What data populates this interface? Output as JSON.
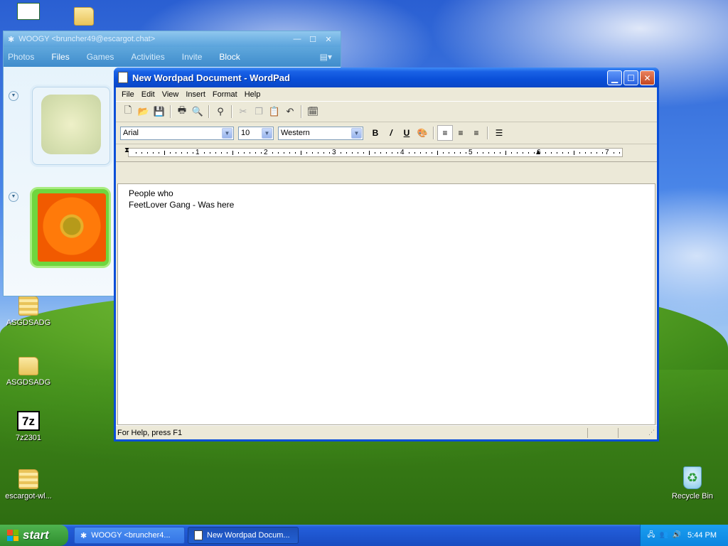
{
  "desktop": {
    "icons": [
      {
        "label": "ASGDSADG"
      },
      {
        "label": "ASGDSADG"
      },
      {
        "label": "7z2301"
      },
      {
        "label": "escargot-wl..."
      },
      {
        "label": "Recycle Bin"
      }
    ]
  },
  "messenger": {
    "title": "WOOGY <bruncher49@escargot.chat>",
    "tabs": [
      "Photos",
      "Files",
      "Games",
      "Activities",
      "Invite",
      "Block"
    ],
    "active_tab": "Files"
  },
  "wordpad": {
    "title": "New Wordpad Document - WordPad",
    "menu": [
      "File",
      "Edit",
      "View",
      "Insert",
      "Format",
      "Help"
    ],
    "font": "Arial",
    "size": "10",
    "script": "Western",
    "ruler_numbers": [
      "1",
      "2",
      "3",
      "4",
      "5",
      "6",
      "7"
    ],
    "content": [
      "People who",
      "FeetLover Gang - Was here"
    ],
    "status": "For Help, press F1"
  },
  "taskbar": {
    "start_label": "start",
    "tasks": [
      {
        "label": "WOOGY <bruncher4..."
      },
      {
        "label": "New Wordpad Docum..."
      }
    ],
    "clock": "5:44 PM"
  },
  "colors": {
    "xp_blue": "#0a4fd8",
    "taskbar_blue": "#245edb",
    "start_green": "#2e8e2e",
    "tray_blue": "#0c85e0"
  }
}
